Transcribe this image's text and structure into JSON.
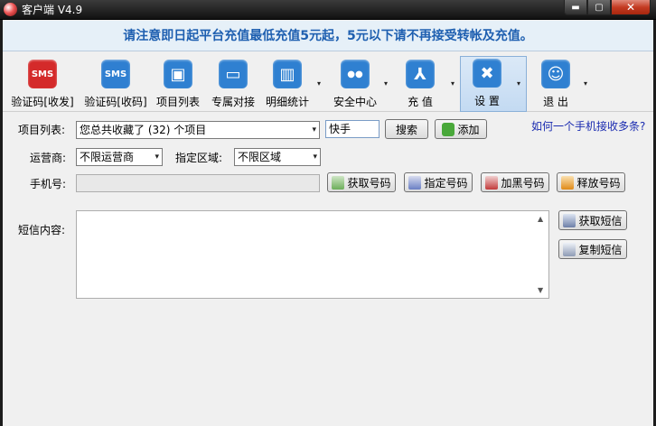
{
  "window": {
    "title": "客户端 V4.9",
    "min": "▬",
    "max": "▢",
    "close": "✕"
  },
  "notice": "请注意即日起平台充值最低充值5元起，5元以下请不再接受转帐及充值。",
  "toolbar": [
    {
      "label": "验证码[收发]",
      "icon": "sms-red-icon",
      "glyph": "SMS",
      "color": "#d42a2a"
    },
    {
      "label": "验证码[收码]",
      "icon": "sms-blue-icon",
      "glyph": "SMS",
      "color": "#2f7fd1"
    },
    {
      "label": "项目列表",
      "icon": "monitor-icon",
      "glyph": "▣",
      "color": "#2f80d1"
    },
    {
      "label": "专属对接",
      "icon": "computer-icon",
      "glyph": "▭",
      "color": "#2f80d1"
    },
    {
      "label": "明细统计",
      "icon": "chart-icon",
      "glyph": "▥",
      "color": "#2f80d1"
    },
    {
      "label": "安全中心",
      "icon": "users-icon",
      "glyph": "●●",
      "color": "#2f80d1"
    },
    {
      "label": "充 值",
      "icon": "pdf-icon",
      "glyph": "⅄",
      "color": "#2f80d1"
    },
    {
      "label": "设 置",
      "icon": "settings-tools-icon",
      "glyph": "✖",
      "color": "#2f80d1"
    },
    {
      "label": "退 出",
      "icon": "exit-person-icon",
      "glyph": "☺",
      "color": "#2f80d1"
    }
  ],
  "arrow": "▾",
  "form": {
    "project_label": "项目列表:",
    "project_value": "您总共收藏了 (32) 个项目",
    "search_value": "快手",
    "search_button": "搜索",
    "add_button": "添加",
    "help_link": "如何一个手机接收多条?",
    "carrier_label": "运营商:",
    "carrier_value": "不限运营商",
    "region_label": "指定区域:",
    "region_value": "不限区域",
    "phone_label": "手机号:",
    "phone_value": "",
    "get_number": "获取号码",
    "specify_number": "指定号码",
    "blacklist_number": "加黑号码",
    "release_number": "释放号码",
    "sms_label": "短信内容:",
    "sms_value": "",
    "get_sms": "获取短信",
    "copy_sms": "复制短信"
  }
}
